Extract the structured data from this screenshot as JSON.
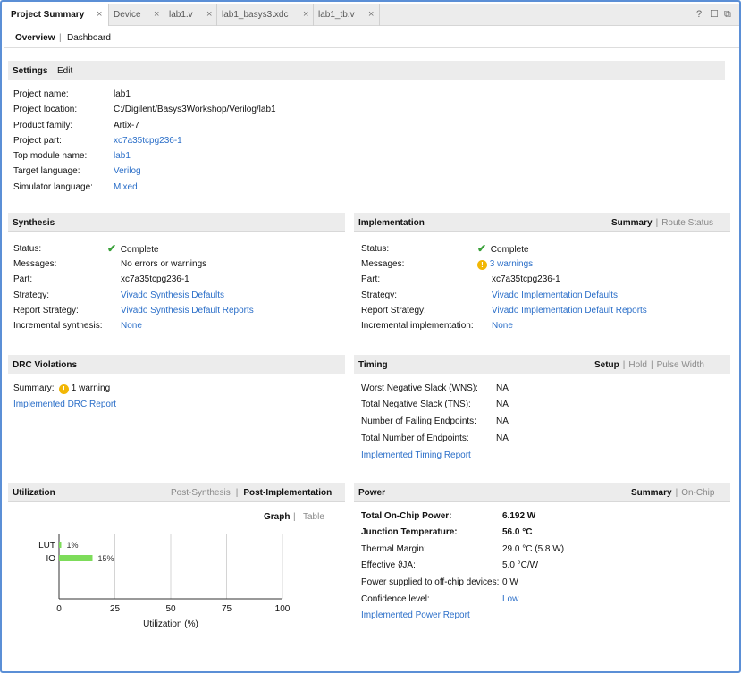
{
  "tabs": [
    {
      "label": "Project Summary",
      "active": true
    },
    {
      "label": "Device",
      "active": false
    },
    {
      "label": "lab1.v",
      "active": false
    },
    {
      "label": "lab1_basys3.xdc",
      "active": false
    },
    {
      "label": "lab1_tb.v",
      "active": false
    }
  ],
  "window_controls": {
    "help": "?",
    "restore": "☐",
    "float": "⧉"
  },
  "subnav": {
    "overview": "Overview",
    "separator": "|",
    "dashboard": "Dashboard"
  },
  "settings": {
    "title": "Settings",
    "edit": "Edit",
    "rows": [
      {
        "label": "Project name:",
        "value": "lab1",
        "link": false
      },
      {
        "label": "Project location:",
        "value": "C:/Digilent/Basys3Workshop/Verilog/lab1",
        "link": false
      },
      {
        "label": "Product family:",
        "value": "Artix-7",
        "link": false
      },
      {
        "label": "Project part:",
        "value": "xc7a35tcpg236-1",
        "link": true
      },
      {
        "label": "Top module name:",
        "value": "lab1",
        "link": true
      },
      {
        "label": "Target language:",
        "value": "Verilog",
        "link": true
      },
      {
        "label": "Simulator language:",
        "value": "Mixed",
        "link": true
      }
    ]
  },
  "synthesis": {
    "title": "Synthesis",
    "rows": [
      {
        "label": "Status:",
        "value": "Complete",
        "icon": "check"
      },
      {
        "label": "Messages:",
        "value": "No errors or warnings",
        "link": false
      },
      {
        "label": "Part:",
        "value": "xc7a35tcpg236-1",
        "link": false
      },
      {
        "label": "Strategy:",
        "value": "Vivado Synthesis Defaults",
        "link": true
      },
      {
        "label": "Report Strategy:",
        "value": "Vivado Synthesis Default Reports",
        "link": true
      },
      {
        "label": "Incremental synthesis:",
        "value": "None",
        "link": true
      }
    ]
  },
  "implementation": {
    "title": "Implementation",
    "tab_summary": "Summary",
    "tab_route": "Route Status",
    "rows": [
      {
        "label": "Status:",
        "value": "Complete",
        "icon": "check"
      },
      {
        "label": "Messages:",
        "value": "3 warnings",
        "icon": "warn",
        "link": true
      },
      {
        "label": "Part:",
        "value": "xc7a35tcpg236-1",
        "link": false
      },
      {
        "label": "Strategy:",
        "value": "Vivado Implementation Defaults",
        "link": true
      },
      {
        "label": "Report Strategy:",
        "value": "Vivado Implementation Default Reports",
        "link": true
      },
      {
        "label": "Incremental implementation:",
        "value": "None",
        "link": true
      }
    ]
  },
  "drc": {
    "title": "DRC Violations",
    "summary_label": "Summary:",
    "summary_value": "1 warning",
    "report_link": "Implemented DRC Report"
  },
  "timing": {
    "title": "Timing",
    "tab_setup": "Setup",
    "tab_hold": "Hold",
    "tab_pulse": "Pulse Width",
    "rows": [
      {
        "label": "Worst Negative Slack (WNS):",
        "value": "NA"
      },
      {
        "label": "Total Negative Slack (TNS):",
        "value": "NA"
      },
      {
        "label": "Number of Failing Endpoints:",
        "value": "NA"
      },
      {
        "label": "Total Number of Endpoints:",
        "value": "NA"
      }
    ],
    "report_link": "Implemented Timing Report"
  },
  "utilization": {
    "title": "Utilization",
    "tab_post_synth": "Post-Synthesis",
    "tab_post_impl": "Post-Implementation",
    "view_graph": "Graph",
    "view_table": "Table",
    "accent": "#7ddc5a",
    "chart_data": {
      "type": "bar",
      "orientation": "horizontal",
      "categories": [
        "LUT",
        "IO"
      ],
      "values": [
        1,
        15
      ],
      "data_labels": [
        "1%",
        "15%"
      ],
      "xlabel": "Utilization (%)",
      "xlim": [
        0,
        100
      ],
      "xticks": [
        "0",
        "25",
        "50",
        "75",
        "100"
      ]
    }
  },
  "power": {
    "title": "Power",
    "tab_summary": "Summary",
    "tab_onchip": "On-Chip",
    "rows": [
      {
        "label": "Total On-Chip Power:",
        "value": "6.192 W",
        "bold": true
      },
      {
        "label": "Junction Temperature:",
        "value": "56.0 °C",
        "bold": true
      },
      {
        "label": "Thermal Margin:",
        "value": "29.0 °C (5.8 W)"
      },
      {
        "label": "Effective ϑJA:",
        "value": "5.0 °C/W"
      },
      {
        "label": "Power supplied to off-chip devices:",
        "value": "0 W"
      },
      {
        "label": "Confidence level:",
        "value": "Low",
        "link": true
      }
    ],
    "report_link": "Implemented Power Report"
  }
}
